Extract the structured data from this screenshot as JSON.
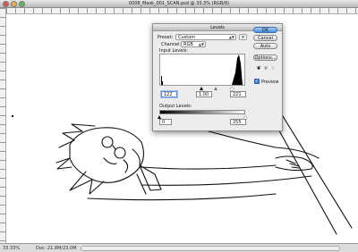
{
  "window": {
    "title": "0008_Mask_001_SCAN.psd @ 33.3% (RGB/8)"
  },
  "status": {
    "zoom": "33.33%",
    "doc": "Doc: 21.8M/23.0M"
  },
  "levels": {
    "title": "Levels",
    "preset_label": "Preset:",
    "preset_value": "Custom",
    "channel_label": "Channel:",
    "channel_value": "RGB",
    "input_label": "Input Levels:",
    "input_black": "122",
    "input_gamma": "1.00",
    "input_white": "221",
    "output_label": "Output Levels:",
    "output_black": "0",
    "output_white": "255",
    "buttons": {
      "ok": "OK",
      "cancel": "Cancel",
      "auto": "Auto",
      "options": "Options..."
    },
    "preview_label": "Preview",
    "preview_checked": true
  },
  "icons": {
    "preset_menu": "options-icon",
    "eyedroppers": [
      "black-eyedropper-icon",
      "gray-eyedropper-icon",
      "white-eyedropper-icon"
    ]
  },
  "colors": {
    "ok_button": "#4a8fdd",
    "dialog_bg": "#ececec"
  }
}
